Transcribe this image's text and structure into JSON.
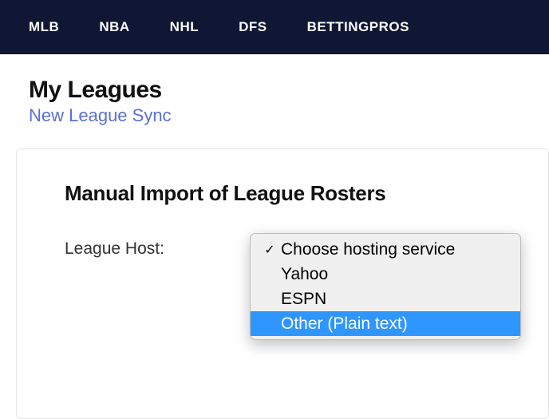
{
  "nav": {
    "items": [
      "MLB",
      "NBA",
      "NHL",
      "DFS",
      "BETTINGPROS"
    ]
  },
  "header": {
    "title": "My Leagues",
    "subtitle": "New League Sync"
  },
  "card": {
    "title": "Manual Import of League Rosters",
    "form": {
      "host_label": "League Host:"
    }
  },
  "dropdown": {
    "items": [
      {
        "label": "Choose hosting service",
        "selected": true,
        "highlighted": false
      },
      {
        "label": "Yahoo",
        "selected": false,
        "highlighted": false
      },
      {
        "label": "ESPN",
        "selected": false,
        "highlighted": false
      },
      {
        "label": "Other (Plain text)",
        "selected": false,
        "highlighted": true
      }
    ]
  }
}
